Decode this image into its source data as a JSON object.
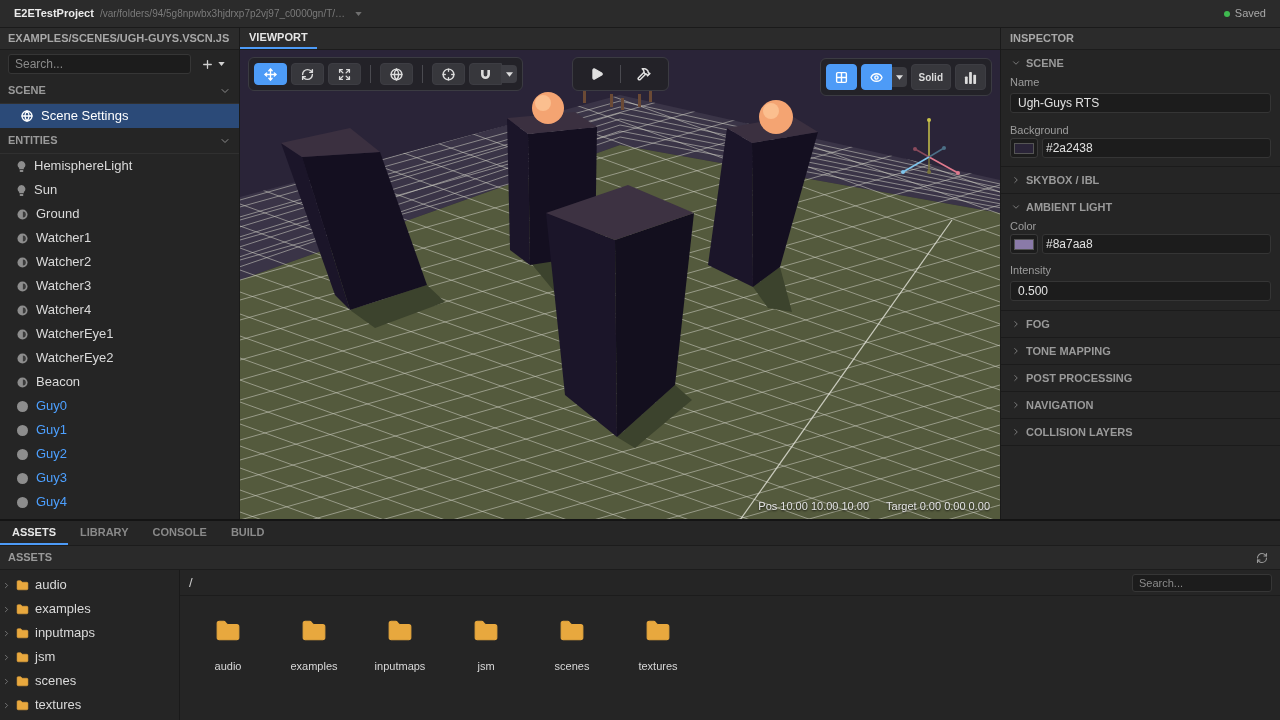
{
  "title_bar": {
    "project": "E2ETestProject",
    "path": "/var/folders/94/5g8npwbx3hjdrxp7p2vj97_c0000gn/T/…",
    "status": "Saved"
  },
  "hierarchy": {
    "file": "EXAMPLES/SCENES/UGH-GUYS.VSCN.JS",
    "search": {
      "placeholder": "Search..."
    },
    "sections": [
      {
        "title": "SCENE",
        "expanded": true,
        "items": [
          {
            "name": "Scene Settings",
            "kind": "settings",
            "selected": true
          }
        ]
      },
      {
        "title": "ENTITIES",
        "expanded": true,
        "items": [
          {
            "name": "HemisphereLight",
            "kind": "light",
            "selected": false
          },
          {
            "name": "Sun",
            "kind": "light",
            "selected": false
          },
          {
            "name": "Ground",
            "kind": "mesh",
            "selected": false
          },
          {
            "name": "Watcher1",
            "kind": "mesh",
            "selected": false
          },
          {
            "name": "Watcher2",
            "kind": "mesh",
            "selected": false
          },
          {
            "name": "Watcher3",
            "kind": "mesh",
            "selected": false
          },
          {
            "name": "Watcher4",
            "kind": "mesh",
            "selected": false
          },
          {
            "name": "WatcherEye1",
            "kind": "mesh",
            "selected": false
          },
          {
            "name": "WatcherEye2",
            "kind": "mesh",
            "selected": false
          },
          {
            "name": "Beacon",
            "kind": "mesh",
            "selected": false
          },
          {
            "name": "Guy0",
            "kind": "prefab",
            "selected": false
          },
          {
            "name": "Guy1",
            "kind": "prefab",
            "selected": false
          },
          {
            "name": "Guy2",
            "kind": "prefab",
            "selected": false
          },
          {
            "name": "Guy3",
            "kind": "prefab",
            "selected": false
          },
          {
            "name": "Guy4",
            "kind": "prefab",
            "selected": false
          }
        ]
      }
    ]
  },
  "viewport": {
    "tab": {
      "label": "VIEWPORT",
      "selected": true
    },
    "transform_toolbar": [
      {
        "tools": [
          {
            "kind": "move",
            "selected": true
          },
          {
            "kind": "rotate",
            "selected": false
          },
          {
            "kind": "scale",
            "selected": false
          }
        ]
      },
      {
        "tools": [
          {
            "kind": "world",
            "selected": false
          }
        ]
      },
      {
        "tools": [
          {
            "kind": "pivot",
            "selected": false
          },
          {
            "kind": "snap",
            "selected": false,
            "dropdown": true
          }
        ]
      }
    ],
    "run_toolbar": [
      {
        "kind": "play"
      },
      {
        "kind": "build"
      }
    ],
    "view_toolbar": [
      {
        "kind": "grid",
        "selected": true
      },
      {
        "kind": "visibility",
        "selected": true,
        "dropdown": true
      },
      {
        "kind": "shading",
        "label": "Solid",
        "selected": false
      },
      {
        "kind": "stats",
        "selected": false
      }
    ],
    "camera": {
      "position": "Pos 10.00 10.00 10.00",
      "target": "Target 0.00 0.00 0.00"
    }
  },
  "inspector": {
    "title": "INSPECTOR",
    "sections": [
      {
        "title": "SCENE",
        "expanded": true,
        "fields": [
          {
            "kind": "text",
            "label": "Name",
            "value": "Ugh-Guys RTS"
          },
          {
            "kind": "color",
            "label": "Background",
            "value": "#2a2438",
            "color": "#2a2438"
          }
        ]
      },
      {
        "title": "SKYBOX / IBL",
        "expanded": false
      },
      {
        "title": "AMBIENT LIGHT",
        "expanded": true,
        "fields": [
          {
            "kind": "color",
            "label": "Color",
            "value": "#8a7aa8",
            "color": "#8a7aa8"
          },
          {
            "kind": "number",
            "label": "Intensity",
            "value": "0.500"
          }
        ]
      },
      {
        "title": "FOG",
        "expanded": false
      },
      {
        "title": "TONE MAPPING",
        "expanded": false
      },
      {
        "title": "POST PROCESSING",
        "expanded": false
      },
      {
        "title": "NAVIGATION",
        "expanded": false
      },
      {
        "title": "COLLISION LAYERS",
        "expanded": false
      }
    ]
  },
  "bottom_panel": {
    "tabs": [
      {
        "label": "ASSETS",
        "selected": true
      },
      {
        "label": "LIBRARY",
        "selected": false
      },
      {
        "label": "CONSOLE",
        "selected": false
      },
      {
        "label": "BUILD",
        "selected": false
      }
    ],
    "assets": {
      "title": "ASSETS",
      "tree": [
        {
          "name": "audio",
          "expanded": false,
          "selected": false
        },
        {
          "name": "examples",
          "expanded": false,
          "selected": false
        },
        {
          "name": "inputmaps",
          "expanded": false,
          "selected": false
        },
        {
          "name": "jsm",
          "expanded": false,
          "selected": false
        },
        {
          "name": "scenes",
          "expanded": false,
          "selected": false
        },
        {
          "name": "textures",
          "expanded": false,
          "selected": false
        }
      ],
      "path": "/",
      "search": {
        "placeholder": "Search..."
      },
      "items": [
        {
          "name": "audio",
          "selected": false
        },
        {
          "name": "examples",
          "selected": false
        },
        {
          "name": "inputmaps",
          "selected": false
        },
        {
          "name": "jsm",
          "selected": false
        },
        {
          "name": "scenes",
          "selected": false
        },
        {
          "name": "textures",
          "selected": false
        }
      ]
    }
  }
}
